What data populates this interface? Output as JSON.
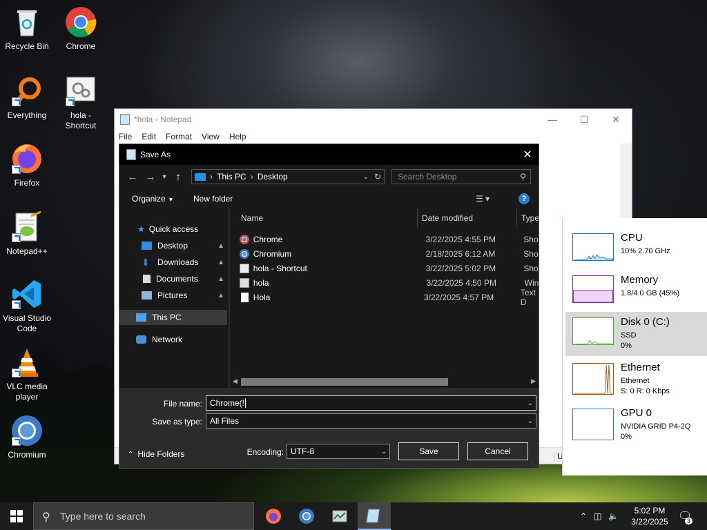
{
  "desktop": {
    "icons": [
      {
        "label": "Recycle Bin",
        "icon": "recycle-bin-icon"
      },
      {
        "label": "Chrome",
        "icon": "chrome-icon"
      },
      {
        "label": "Everything",
        "icon": "everything-search-icon"
      },
      {
        "label": "hola - Shortcut",
        "icon": "gears-shortcut-icon"
      },
      {
        "label": "Firefox",
        "icon": "firefox-icon"
      },
      {
        "label": "Notepad++",
        "icon": "notepadpp-icon"
      },
      {
        "label": "Visual Studio Code",
        "icon": "vscode-icon"
      },
      {
        "label": "VLC media player",
        "icon": "vlc-icon"
      },
      {
        "label": "Chromium",
        "icon": "chromium-icon"
      }
    ]
  },
  "notepad": {
    "title": "*hola - Notepad",
    "menu": [
      "File",
      "Edit",
      "Format",
      "View",
      "Help"
    ],
    "status_encoding": "UTF"
  },
  "dialog": {
    "title": "Save As",
    "address": {
      "root": "This PC",
      "folder": "Desktop"
    },
    "search_placeholder": "Search Desktop",
    "toolbar": {
      "organize": "Organize",
      "new_folder": "New folder"
    },
    "nav": {
      "quick_access": "Quick access",
      "items": [
        "Desktop",
        "Downloads",
        "Documents",
        "Pictures"
      ],
      "this_pc": "This PC",
      "network": "Network"
    },
    "columns": {
      "name": "Name",
      "date": "Date modified",
      "type": "Type"
    },
    "files": [
      {
        "name": "Chrome",
        "date": "3/22/2025 4:55 PM",
        "type": "Short"
      },
      {
        "name": "Chromium",
        "date": "2/18/2025 6:12 AM",
        "type": "Short"
      },
      {
        "name": "hola - Shortcut",
        "date": "3/22/2025 5:02 PM",
        "type": "Short"
      },
      {
        "name": "hola",
        "date": "3/22/2025 4:50 PM",
        "type": "Wind"
      },
      {
        "name": "Hola",
        "date": "3/22/2025 4:57 PM",
        "type": "Text D"
      }
    ],
    "file_name_label": "File name:",
    "file_name_value": "Chrome(!",
    "save_type_label": "Save as type:",
    "save_type_value": "All Files",
    "hide_folders": "Hide Folders",
    "encoding_label": "Encoding:",
    "encoding_value": "UTF-8",
    "save_button": "Save",
    "cancel_button": "Cancel"
  },
  "task_manager": {
    "items": [
      {
        "name": "CPU",
        "line1": "10% 2.70 GHz",
        "line2": "",
        "color": "#1f78c1"
      },
      {
        "name": "Memory",
        "line1": "1.8/4.0 GB (45%)",
        "line2": "",
        "color": "#8b2fa8"
      },
      {
        "name": "Disk 0 (C:)",
        "line1": "SSD",
        "line2": "0%",
        "color": "#4ea72e"
      },
      {
        "name": "Ethernet",
        "line1": "Ethernet",
        "line2": "S: 0 R: 0 Kbps",
        "color": "#a05a13"
      },
      {
        "name": "GPU 0",
        "line1": "NVIDIA GRID P4-2Q",
        "line2": "0%",
        "color": "#1f78c1"
      }
    ]
  },
  "taskbar": {
    "search_placeholder": "Type here to search",
    "time": "5:02 PM",
    "date": "3/22/2025",
    "notification_count": "3"
  }
}
